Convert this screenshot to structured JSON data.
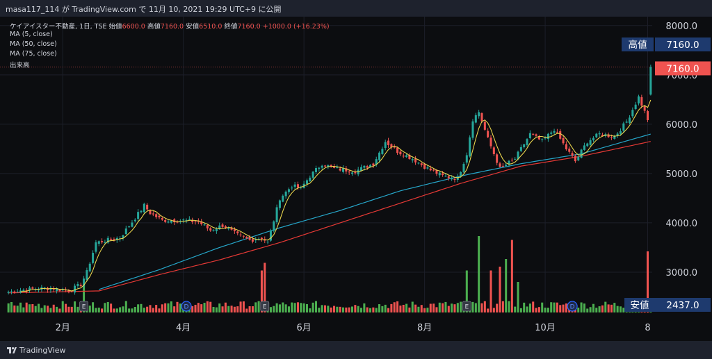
{
  "header": {
    "publish_line": "masa117_114 が TradingView.com で 11月 10, 2021 19:29 UTC+9 に公開"
  },
  "legend": {
    "symbol": "ケイアイスター不動産, 1日, TSE",
    "open_label": "始値",
    "open_value": "6600.0",
    "high_label": "高値",
    "high_value": "7160.0",
    "low_label": "安値",
    "low_value": "6510.0",
    "close_label": "終値",
    "close_value": "7160.0",
    "change": "+1000.0 (+16.23%)",
    "ma5": "MA (5, close)",
    "ma50": "MA (50, close)",
    "ma75": "MA (75, close)",
    "volume": "出来高"
  },
  "footer": {
    "brand": "TradingView"
  },
  "markers": {
    "earnings": "E",
    "dividend": "D"
  },
  "colors": {
    "up": "#26a69a",
    "down": "#ef5350",
    "vol_up": "#4caf50",
    "vol_down": "#ef5350",
    "ma5": "#e8d44d",
    "ma50": "#26a6c9",
    "ma75": "#e53935",
    "label_bg": "#2962ff",
    "label_navy": "#1e3a6e"
  },
  "chart_data": {
    "type": "candlestick",
    "title": "ケイアイスター不動産, 1日, TSE",
    "y_ticks": [
      "3000.0",
      "4000.0",
      "5000.0",
      "6000.0",
      "7000.0",
      "8000.0"
    ],
    "y_tick_values": [
      3000,
      4000,
      5000,
      6000,
      7000,
      8000
    ],
    "ylim": [
      2380,
      8180
    ],
    "x_ticks": [
      "2月",
      "4月",
      "6月",
      "8月",
      "10月",
      "8"
    ],
    "x_tick_index": [
      18,
      58,
      98,
      138,
      178,
      212
    ],
    "bar_count": 214,
    "last_price_label": "7160.0",
    "high_label": {
      "text": "高値",
      "value": "7160.0"
    },
    "low_label": {
      "text": "安値",
      "value": "2437.0"
    },
    "earnings_markers_at": [
      25,
      85,
      152
    ],
    "dividend_markers_at": [
      59,
      187
    ],
    "waypoints": [
      [
        0,
        2600
      ],
      [
        6,
        2650
      ],
      [
        14,
        2680
      ],
      [
        20,
        2620
      ],
      [
        24,
        2750
      ],
      [
        26,
        3000
      ],
      [
        29,
        3600
      ],
      [
        33,
        3650
      ],
      [
        37,
        3700
      ],
      [
        42,
        4100
      ],
      [
        45,
        4350
      ],
      [
        47,
        4200
      ],
      [
        51,
        4050
      ],
      [
        58,
        4050
      ],
      [
        63,
        4020
      ],
      [
        67,
        3850
      ],
      [
        71,
        3950
      ],
      [
        76,
        3750
      ],
      [
        80,
        3650
      ],
      [
        84,
        3700
      ],
      [
        86,
        3600
      ],
      [
        90,
        4500
      ],
      [
        94,
        4750
      ],
      [
        97,
        4700
      ],
      [
        100,
        4950
      ],
      [
        104,
        5200
      ],
      [
        108,
        5100
      ],
      [
        115,
        5050
      ],
      [
        121,
        5200
      ],
      [
        125,
        5650
      ],
      [
        129,
        5450
      ],
      [
        134,
        5300
      ],
      [
        139,
        5100
      ],
      [
        144,
        4950
      ],
      [
        149,
        4900
      ],
      [
        152,
        5400
      ],
      [
        154,
        6100
      ],
      [
        156,
        6250
      ],
      [
        159,
        5700
      ],
      [
        163,
        5100
      ],
      [
        168,
        5300
      ],
      [
        173,
        5800
      ],
      [
        177,
        5650
      ],
      [
        181,
        5900
      ],
      [
        185,
        5500
      ],
      [
        188,
        5250
      ],
      [
        192,
        5650
      ],
      [
        196,
        5800
      ],
      [
        201,
        5750
      ],
      [
        205,
        6050
      ],
      [
        209,
        6550
      ],
      [
        211,
        6250
      ],
      [
        212,
        6100
      ],
      [
        213,
        6900
      ]
    ],
    "ma50_waypoints": [
      [
        30,
        2650
      ],
      [
        50,
        3050
      ],
      [
        70,
        3500
      ],
      [
        90,
        3900
      ],
      [
        110,
        4250
      ],
      [
        130,
        4650
      ],
      [
        150,
        4950
      ],
      [
        170,
        5200
      ],
      [
        190,
        5400
      ],
      [
        213,
        5800
      ]
    ],
    "ma75_waypoints": [
      [
        0,
        2580
      ],
      [
        30,
        2620
      ],
      [
        50,
        2950
      ],
      [
        70,
        3250
      ],
      [
        90,
        3600
      ],
      [
        110,
        4000
      ],
      [
        130,
        4400
      ],
      [
        150,
        4800
      ],
      [
        170,
        5150
      ],
      [
        190,
        5350
      ],
      [
        213,
        5650
      ]
    ],
    "volume_spikes": [
      [
        25,
        0.38
      ],
      [
        84,
        0.55
      ],
      [
        85,
        0.65
      ],
      [
        152,
        0.55
      ],
      [
        156,
        1.0
      ],
      [
        160,
        0.55
      ],
      [
        163,
        0.6
      ],
      [
        165,
        0.7
      ],
      [
        167,
        0.95
      ],
      [
        169,
        0.4
      ],
      [
        212,
        0.8
      ]
    ]
  }
}
